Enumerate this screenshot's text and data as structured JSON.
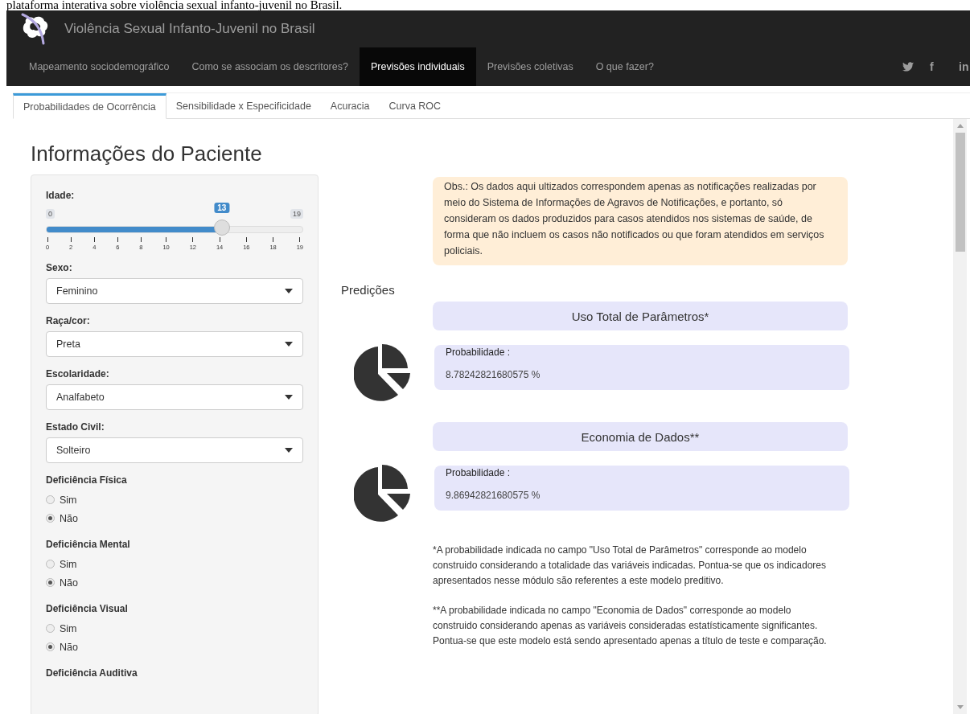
{
  "caption": "plataforma interativa sobre violência sexual infanto-juvenil no Brasil.",
  "header": {
    "title": "Violência Sexual Infanto-Juvenil no Brasil"
  },
  "nav": [
    {
      "label": "Mapeamento sociodemográfico",
      "selected": false
    },
    {
      "label": "Como se associam os descritores?",
      "selected": false
    },
    {
      "label": "Previsões individuais",
      "selected": true
    },
    {
      "label": "Previsões coletivas",
      "selected": false
    },
    {
      "label": "O que fazer?",
      "selected": false
    }
  ],
  "social": [
    {
      "kind": "bird"
    },
    {
      "kind": "glyph",
      "text": "f"
    },
    {
      "kind": "glyph",
      "text": "in"
    }
  ],
  "tabs": [
    {
      "label": "Probabilidades de Ocorrência",
      "selected": true
    },
    {
      "label": "Sensibilidade x Especificidade",
      "selected": false
    },
    {
      "label": "Acuracia",
      "selected": false
    },
    {
      "label": "Curva ROC",
      "selected": false
    }
  ],
  "heading": "Informações do Paciente",
  "form": [
    {
      "kind": "slider",
      "label": "Idade:",
      "min": "0",
      "max": "19",
      "value": "13",
      "level": 0.684,
      "ticks": [
        "0",
        "2",
        "4",
        "6",
        "8",
        "10",
        "12",
        "14",
        "16",
        "18",
        "19"
      ]
    },
    {
      "kind": "select",
      "label": "Sexo:",
      "value": "Feminino"
    },
    {
      "kind": "select",
      "label": "Raça/cor:",
      "value": "Preta"
    },
    {
      "kind": "select",
      "label": "Escolaridade:",
      "value": "Analfabeto"
    },
    {
      "kind": "select",
      "label": "Estado Civil:",
      "value": "Solteiro"
    },
    {
      "kind": "radio",
      "label": "Deficiência Física",
      "options": [
        {
          "label": "Sim",
          "selected": false
        },
        {
          "label": "Não",
          "selected": true
        }
      ]
    },
    {
      "kind": "radio",
      "label": "Deficiência Mental",
      "options": [
        {
          "label": "Sim",
          "selected": false
        },
        {
          "label": "Não",
          "selected": true
        }
      ]
    },
    {
      "kind": "radio",
      "label": "Deficiência Visual",
      "options": [
        {
          "label": "Sim",
          "selected": false
        },
        {
          "label": "Não",
          "selected": true
        }
      ]
    },
    {
      "kind": "radio",
      "label": "Deficiência Auditiva"
    }
  ],
  "obs": "Obs.: Os dados aqui ultizados correspondem apenas as notificações realizadas por meio do Sistema de Informações de Agravos de Notificações, e portanto, só consideram os dados produzidos para casos atendidos nos sistemas de saúde, de forma que não incluem os casos não notificados ou que foram atendidos em serviços policiais.",
  "predictions_label": "Predições",
  "predictions": [
    {
      "title": "Uso Total de Parâmetros*",
      "label": "Probabilidade :",
      "value": "8.78242821680575 %"
    },
    {
      "title": "Economia de Dados**",
      "label": "Probabilidade :",
      "value": "9.86942821680575 %"
    }
  ],
  "notes": [
    "*A probabilidade indicada no campo \"Uso Total de Parâmetros\" corresponde ao modelo construido considerando a totalidade das variáveis indicadas. Pontua-se que os indicadores apresentados nesse módulo são referentes a este modelo preditivo.",
    "**A probabilidade indicada no campo \"Economia de Dados\" corresponde ao modelo construido considerando apenas as variáveis consideradas estatísticamente significantes. Pontua-se que este modelo está sendo apresentado apenas a título de teste e comparação."
  ]
}
